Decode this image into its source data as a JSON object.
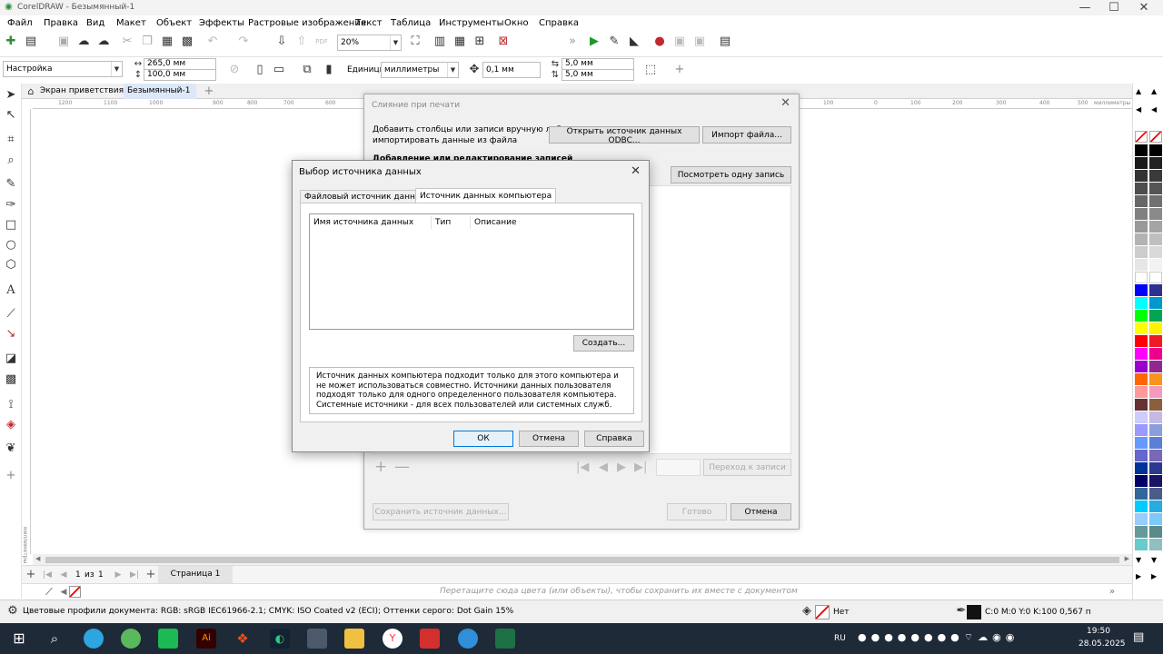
{
  "app": {
    "title": "CorelDRAW - Безымянный-1"
  },
  "menu": [
    "Файл",
    "Правка",
    "Вид",
    "Макет",
    "Объект",
    "Эффекты",
    "Растровые изображения",
    "Текст",
    "Таблица",
    "Инструменты",
    "Окно",
    "Справка"
  ],
  "toolbar": {
    "zoom": "20%"
  },
  "propbar": {
    "preset": "Настройка",
    "width": "265,0 мм",
    "height": "100,0 мм",
    "units_label": "Единицы:",
    "units": "миллиметры",
    "nudge": "0,1 мм",
    "dup_x": "5,0 мм",
    "dup_y": "5,0 мм"
  },
  "doc_tabs": {
    "welcome": "Экран приветствия",
    "doc": "Безымянный-1"
  },
  "ruler": {
    "h_ticks": [
      "1200",
      "1100",
      "1000",
      "900",
      "800",
      "700",
      "600",
      "100",
      "0",
      "100",
      "200",
      "300",
      "400",
      "500"
    ],
    "unit": "миллиметры",
    "v_unit": "миллиметры"
  },
  "pagebar": {
    "counter": "1",
    "of": "из",
    "total": "1",
    "page_tab": "Страница 1"
  },
  "colorbar": {
    "hint": "Перетащите сюда цвета (или объекты), чтобы сохранить их вместе с документом"
  },
  "status": {
    "profiles": "Цветовые профили документа: RGB: sRGB IEC61966-2.1; CMYK: ISO Coated v2 (ECI); Оттенки серого: Dot Gain 15%",
    "fill": "Нет",
    "outline": "C:0 M:0 Y:0 K:100  0,567 п"
  },
  "merge": {
    "title": "Слияние при печати",
    "desc_line1": "Добавить столбцы или записи вручную либо",
    "desc_line2": "импортировать данные из файла",
    "odbc_button": "Открыть источник данных ODBC...",
    "import_button": "Импорт файла...",
    "section": "Добавление или редактирование записей",
    "view_one": "Посмотреть одну запись",
    "goto": "Переход к записи",
    "save_source": "Сохранить источник данных...",
    "done": "Готово",
    "cancel": "Отмена"
  },
  "dialog": {
    "title": "Выбор источника данных",
    "tab_file": "Файловый источник данных",
    "tab_computer": "Источник данных компьютера",
    "col_name": "Имя источника данных",
    "col_type": "Тип",
    "col_desc": "Описание",
    "create": "Создать...",
    "description": "Источник данных компьютера подходит только для этого компьютера и не может использоваться совместно. Источники данных пользователя подходят только для одного определенного пользователя компьютера. Системные источники - для всех пользователей или системных служб.",
    "ok": "ОК",
    "cancel": "Отмена",
    "help": "Справка"
  },
  "tray": {
    "lang": "RU",
    "time": "19:50",
    "date": "28.05.2025"
  },
  "palette_colors": [
    "#000000",
    "#1a1a1a",
    "#333333",
    "#4d4d4d",
    "#666666",
    "#808080",
    "#999999",
    "#b3b3b3",
    "#cccccc",
    "#e6e6e6",
    "#ffffff",
    "#0000ff",
    "#00ffff",
    "#00ff00",
    "#ffff00",
    "#ff0000",
    "#ff00ff",
    "#9900cc",
    "#ff6600",
    "#ff9999",
    "#663333",
    "#ccccff",
    "#9999ff",
    "#6699ff",
    "#6666cc",
    "#003399",
    "#000066",
    "#336699",
    "#00ccff",
    "#99ccff",
    "#669999",
    "#66cccc"
  ],
  "palette_colors2": [
    "#000000",
    "#222222",
    "#3a3a3a",
    "#555555",
    "#707070",
    "#8a8a8a",
    "#a5a5a5",
    "#bfbfbf",
    "#d9d9d9",
    "#f2f2f2",
    "#ffffff",
    "#2e3192",
    "#0099cc",
    "#00a651",
    "#fff200",
    "#ed1c24",
    "#ec008c",
    "#92278f",
    "#f7941d",
    "#f49ac1",
    "#8b5e3c",
    "#c5b9e3",
    "#8c9ed9",
    "#5b7fd4",
    "#7b68b5",
    "#2b3990",
    "#1b1464",
    "#4a5d8a",
    "#29abe2",
    "#7fc8f8",
    "#5b8a8a",
    "#8fbfbf"
  ]
}
